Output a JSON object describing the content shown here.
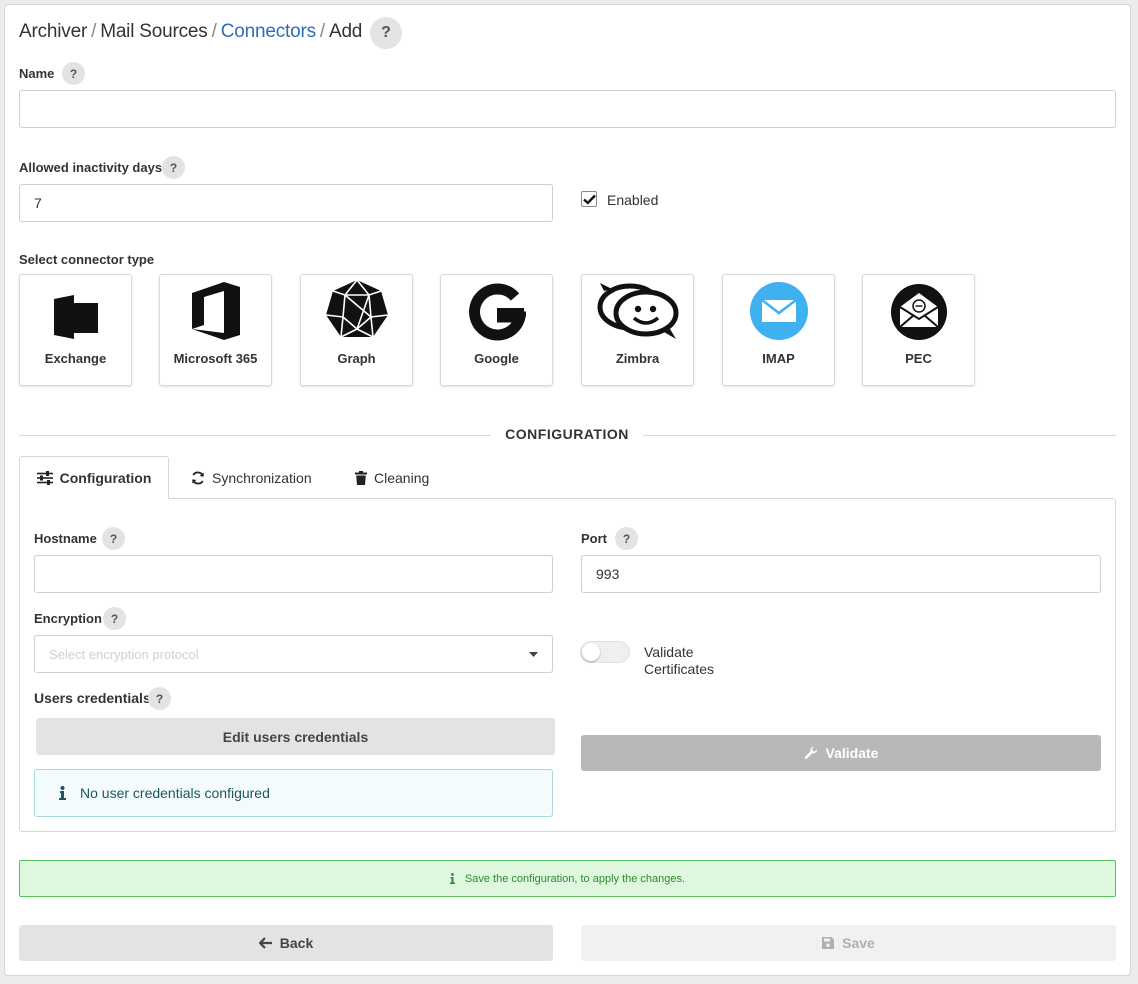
{
  "breadcrumb": {
    "item1": "Archiver",
    "item2": "Mail Sources",
    "item3": "Connectors",
    "item4": "Add",
    "separator": "/",
    "help": "?"
  },
  "form": {
    "name_label": "Name",
    "name_value": "",
    "inactivity_label": "Allowed inactivity days",
    "inactivity_value": "7",
    "enabled_label": "Enabled",
    "enabled_checked": true,
    "connector_type_label": "Select connector type",
    "help": "?"
  },
  "connectors": [
    {
      "name": "Exchange",
      "icon": "exchange-icon"
    },
    {
      "name": "Microsoft 365",
      "icon": "office-icon"
    },
    {
      "name": "Graph",
      "icon": "graph-icon"
    },
    {
      "name": "Google",
      "icon": "google-icon"
    },
    {
      "name": "Zimbra",
      "icon": "zimbra-icon"
    },
    {
      "name": "IMAP",
      "icon": "imap-envelope-icon"
    },
    {
      "name": "PEC",
      "icon": "pec-envelope-icon"
    }
  ],
  "configuration": {
    "section_title": "CONFIGURATION",
    "tabs": [
      {
        "label": "Configuration",
        "icon": "sliders-icon",
        "active": true
      },
      {
        "label": "Synchronization",
        "icon": "sync-icon",
        "active": false
      },
      {
        "label": "Cleaning",
        "icon": "trash-icon",
        "active": false
      }
    ],
    "hostname_label": "Hostname",
    "hostname_value": "",
    "port_label": "Port",
    "port_value": "993",
    "encryption_label": "Encryption",
    "encryption_placeholder": "Select encryption protocol",
    "validate_certificates_label": "Validate Certificates",
    "validate_certificates_on": false,
    "users_credentials_label": "Users credentials",
    "edit_credentials_button": "Edit users credentials",
    "no_credentials_message": "No user credentials configured",
    "validate_button": "Validate"
  },
  "notice": "Save the configuration, to apply the changes.",
  "footer": {
    "back_button": "Back",
    "save_button": "Save"
  },
  "colors": {
    "link": "#2f6db5",
    "validate_bg": "#b8b8b8",
    "success_border": "#58c058",
    "success_bg": "#def7de",
    "imap_blue": "#3fb0f0"
  }
}
